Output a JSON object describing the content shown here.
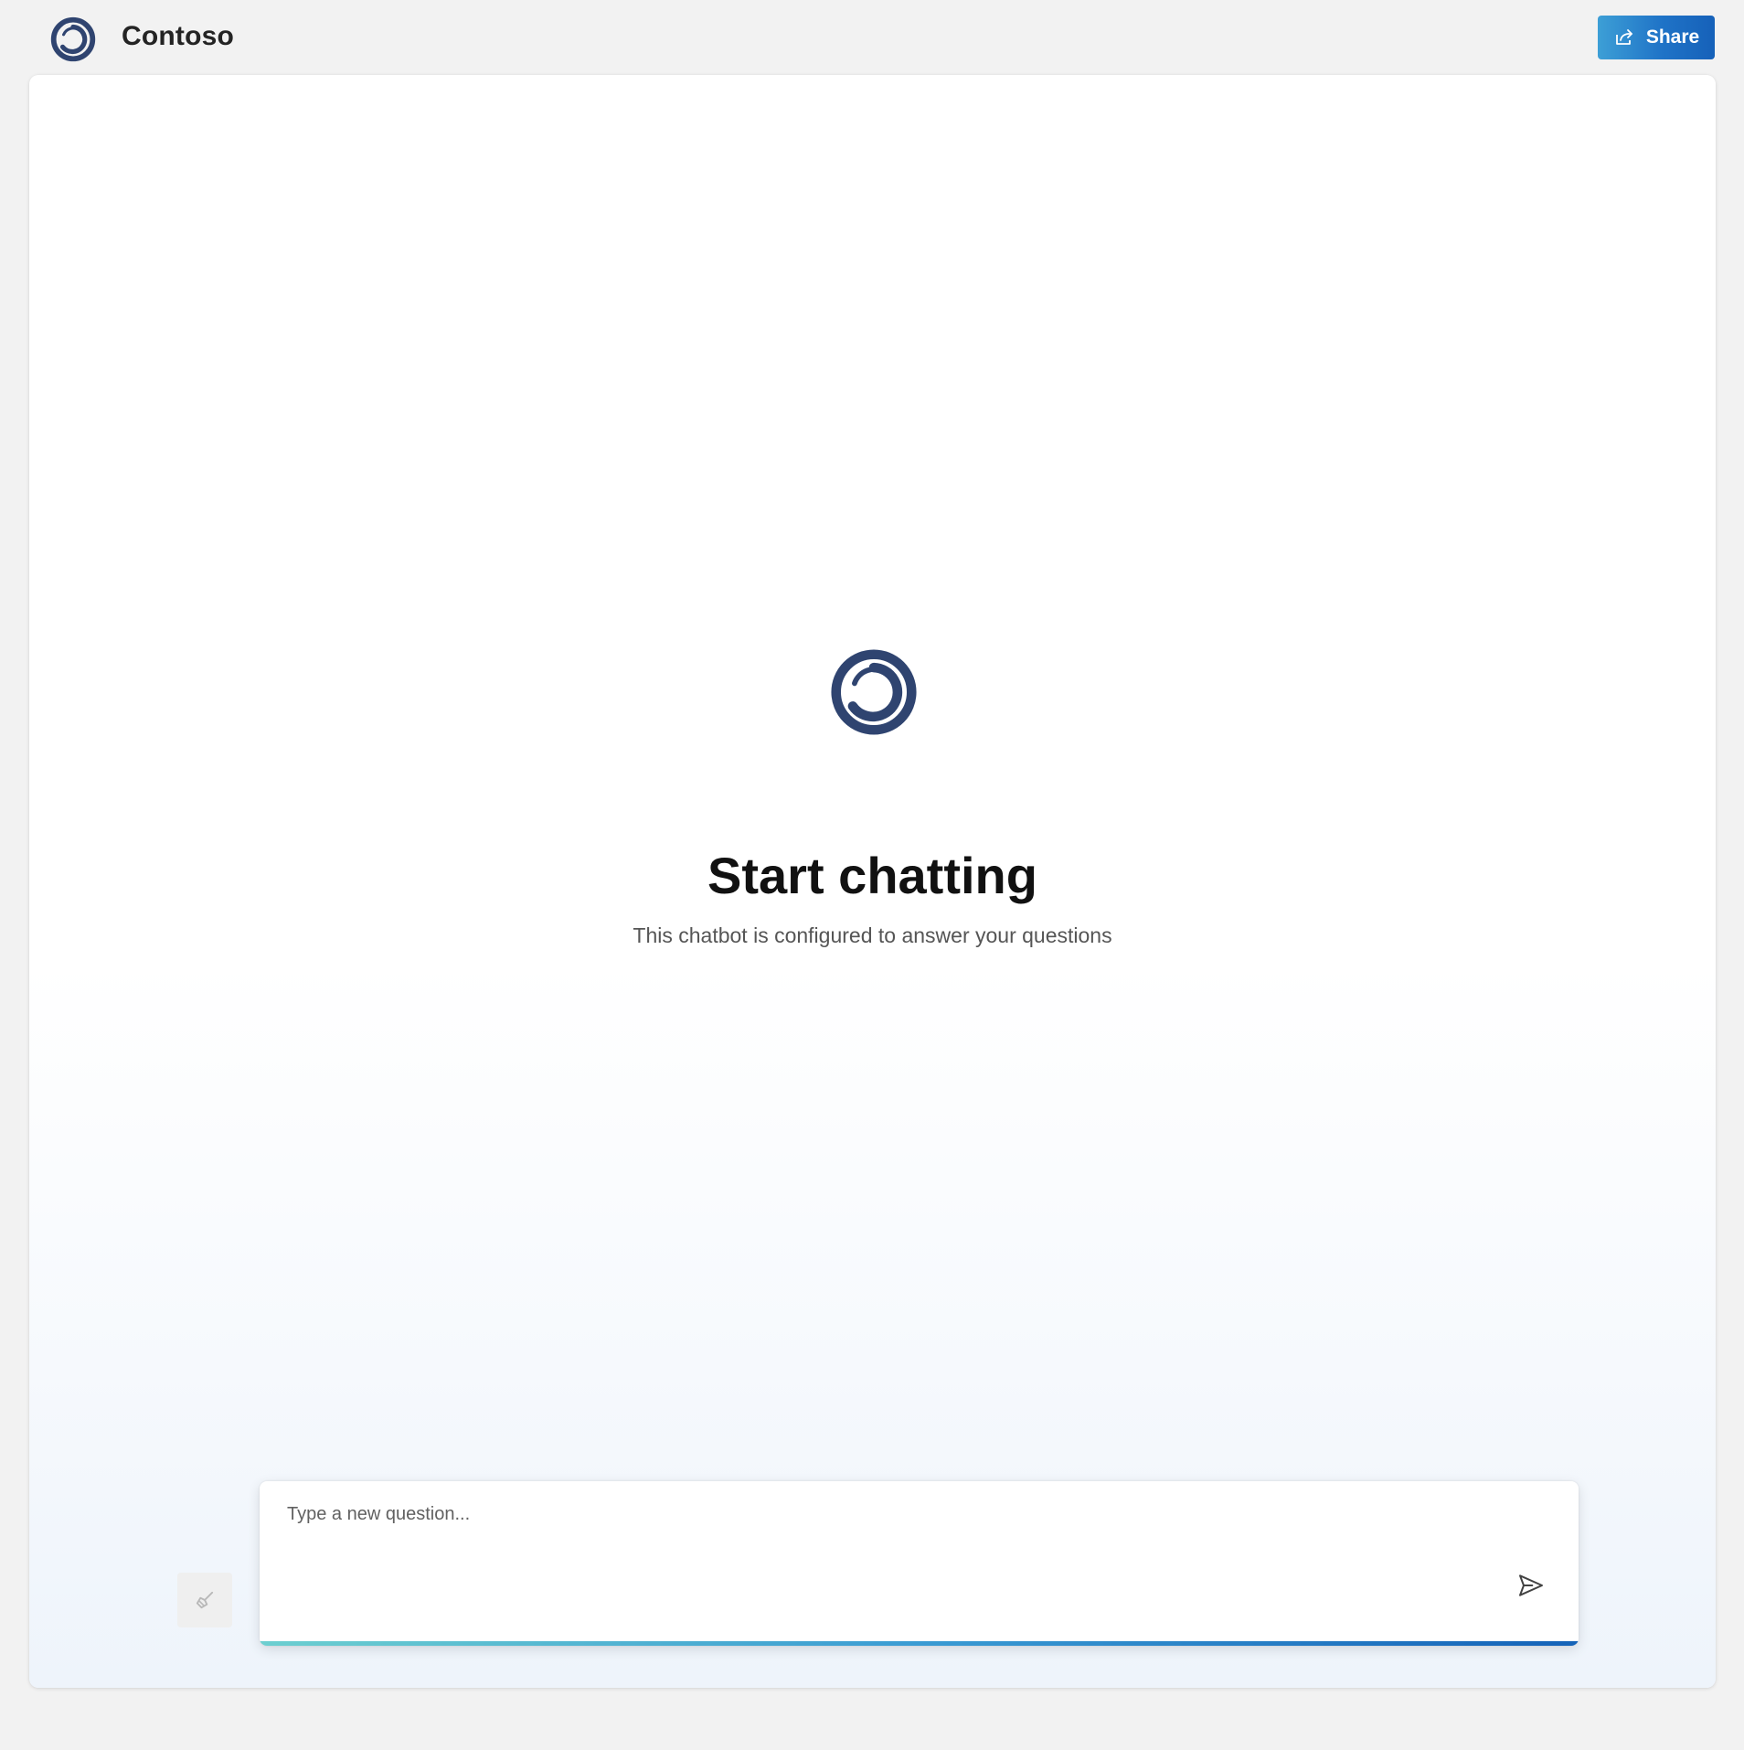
{
  "app": {
    "title": "Contoso",
    "logo_icon": "contoso-swirl-logo-icon",
    "brand_color": "#2f4470"
  },
  "header": {
    "share_label": "Share",
    "share_icon": "share-arrow-icon",
    "share_color": "#1f73c7"
  },
  "empty_state": {
    "title": "Start chatting",
    "subtitle": "This chatbot is configured to answer your questions",
    "icon": "contoso-swirl-logo-icon"
  },
  "composer": {
    "placeholder": "Type a new question...",
    "value": "",
    "send_icon": "send-icon",
    "clear_icon": "broom-icon"
  }
}
